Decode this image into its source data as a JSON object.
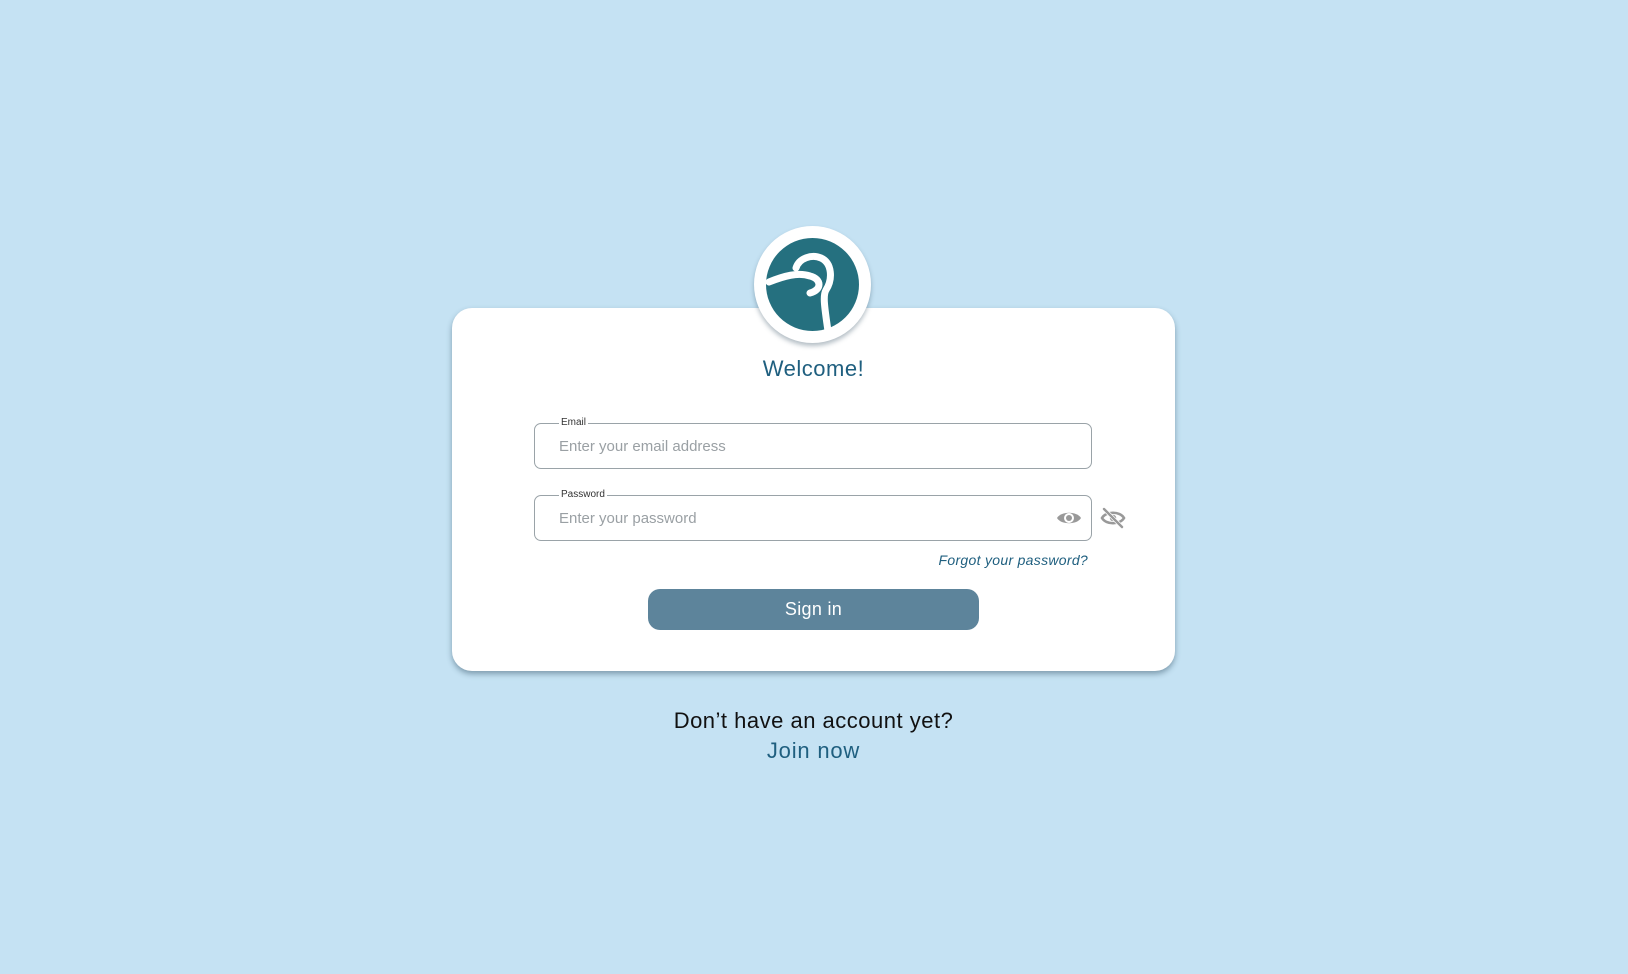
{
  "app": {
    "title": "Welcome!",
    "logo_icon": "brand-logo-icon"
  },
  "login": {
    "email_label": "Email",
    "email_placeholder": "Enter your email address",
    "email_value": "",
    "password_label": "Password",
    "password_placeholder": "Enter your password",
    "password_value": "",
    "show_password_icon": "eye-icon",
    "hide_password_icon": "eye-off-icon",
    "forgot_label": "Forgot your password?",
    "signin_label": "Sign in"
  },
  "footer": {
    "prompt": "Don’t have an account yet?",
    "join_label": "Join now"
  },
  "colors": {
    "background": "#c5e2f3",
    "brand": "#25707f",
    "accent_text": "#1f5f7f",
    "button": "#5d849b"
  }
}
